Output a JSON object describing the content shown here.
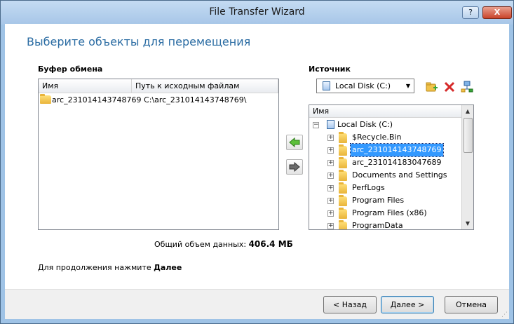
{
  "window": {
    "title": "File Transfer Wizard",
    "help_label": "?",
    "close_label": "X"
  },
  "heading": "Выберите объекты для перемещения",
  "clipboard": {
    "label": "Буфер обмена",
    "columns": [
      "Имя",
      "Путь к исходным файлам"
    ],
    "rows": [
      {
        "name": "arc_231014143748769",
        "path": "C:\\arc_231014143748769\\"
      }
    ]
  },
  "source": {
    "label": "Источник",
    "drive_selected": "Local Disk (C:)",
    "tree_header": "Имя",
    "root": "Local Disk (C:)",
    "items": [
      "$Recycle.Bin",
      "arc_231014143748769",
      "arc_231014183047689",
      "Documents and Settings",
      "PerfLogs",
      "Program Files",
      "Program Files (x86)",
      "ProgramData"
    ],
    "selected_index": 1
  },
  "total": {
    "label": "Общий объем данных:",
    "value": "406.4 МБ"
  },
  "hint": {
    "text": "Для продолжения нажмите",
    "bold": "Далее"
  },
  "buttons": {
    "back": "< Назад",
    "next": "Далее >",
    "cancel": "Отмена"
  },
  "colors": {
    "heading": "#2b6ca3",
    "selection": "#3399ff",
    "add": "#3aa63a",
    "delete": "#d62b2b"
  }
}
